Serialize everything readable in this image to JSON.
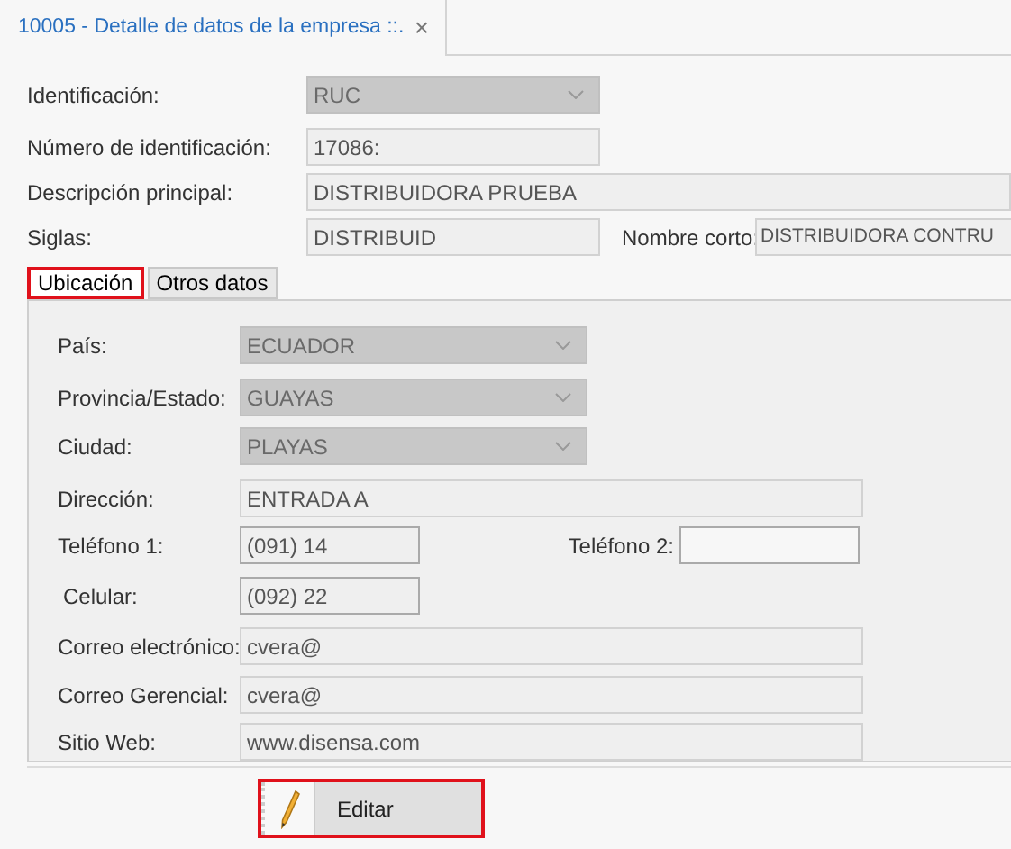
{
  "document_tabs": [
    {
      "title": "10005 - Detalle de datos de la empresa  ::.",
      "close": "×",
      "selected": true
    }
  ],
  "header_rows": [
    [
      {
        "label": "Identificación:",
        "value": "RUC",
        "kind": "combo"
      }
    ],
    [
      {
        "label": "Número de identificación:",
        "value": "17086:",
        "kind": "text"
      }
    ],
    [
      {
        "label": "Descripción principal:",
        "value": "DISTRIBUIDORA PRUEBA",
        "kind": "text"
      }
    ],
    [
      {
        "label": "Siglas:",
        "value": "DISTRIBUID",
        "kind": "text"
      },
      {
        "label": "Nombre corto:",
        "value": "DISTRIBUIDORA CONTRU",
        "kind": "text"
      }
    ]
  ],
  "section_tabs": [
    {
      "label": "Ubicación",
      "selected": true
    },
    {
      "label": "Otros datos",
      "selected": false
    }
  ],
  "panel_rows": [
    [
      {
        "label": "País:",
        "value": "ECUADOR",
        "kind": "combo"
      }
    ],
    [
      {
        "label": "Provincia/Estado:",
        "value": "GUAYAS",
        "kind": "combo"
      }
    ],
    [
      {
        "label": "Ciudad:",
        "value": "PLAYAS",
        "kind": "combo"
      }
    ],
    [
      {
        "label": "Dirección:",
        "value": "ENTRADA A",
        "kind": "text"
      }
    ],
    [
      {
        "label": "Teléfono 1:",
        "value": "(091) 14",
        "kind": "text"
      },
      {
        "label": "Teléfono 2:",
        "kind": "text"
      }
    ],
    [
      {
        "label": "Celular:",
        "value": "(092) 22",
        "kind": "text"
      }
    ],
    [
      {
        "label": "Correo electrónico:",
        "value": "cvera@",
        "kind": "text"
      }
    ],
    [
      {
        "label": "Correo Gerencial:",
        "value": "cvera@",
        "kind": "text"
      }
    ],
    [
      {
        "label": "Sitio Web:",
        "value": "www.disensa.com",
        "kind": "text"
      }
    ]
  ],
  "button": {
    "label": "Editar",
    "focused": true
  }
}
